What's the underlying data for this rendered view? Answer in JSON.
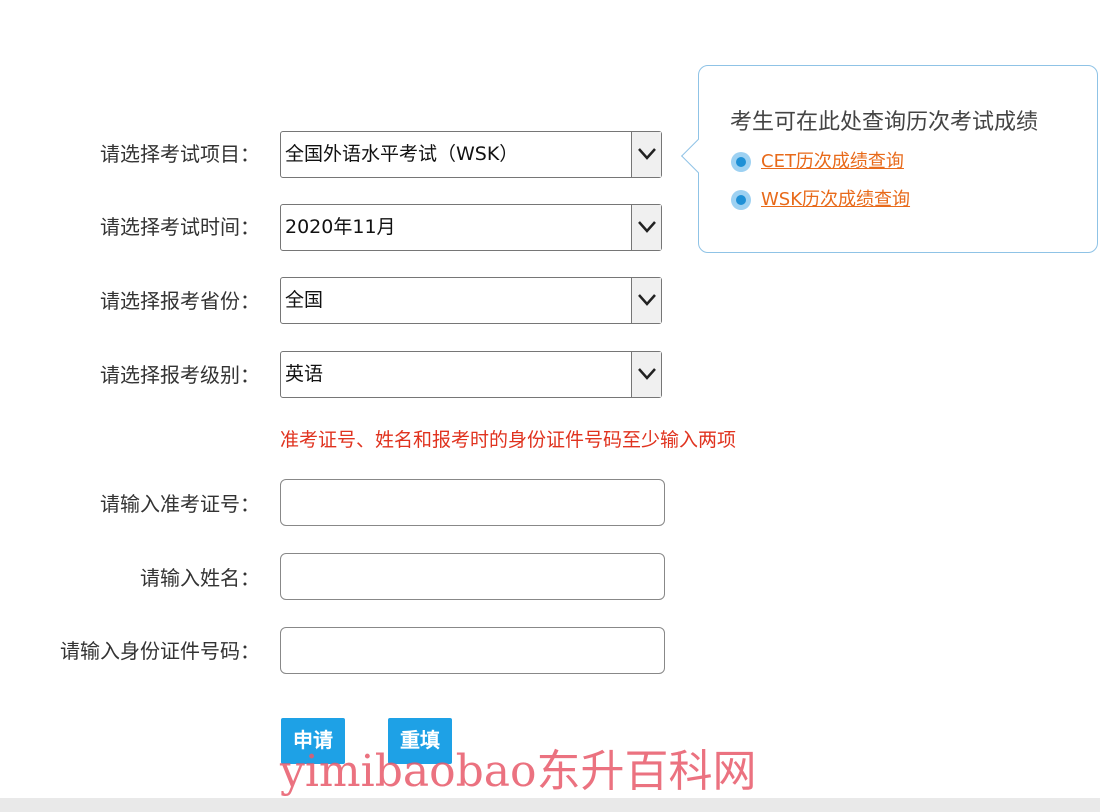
{
  "form": {
    "exam_item": {
      "label": "请选择考试项目：",
      "value": "全国外语水平考试（WSK）"
    },
    "exam_time": {
      "label": "请选择考试时间：",
      "value": "2020年11月"
    },
    "province": {
      "label": "请选择报考省份：",
      "value": "全国"
    },
    "level": {
      "label": "请选择报考级别：",
      "value": "英语"
    },
    "notice": "准考证号、姓名和报考时的身份证件号码至少输入两项",
    "ticket_no": {
      "label": "请输入准考证号：",
      "value": ""
    },
    "name": {
      "label": "请输入姓名：",
      "value": ""
    },
    "id_no": {
      "label": "请输入身份证件号码：",
      "value": ""
    },
    "buttons": {
      "submit": "申请",
      "reset": "重填"
    }
  },
  "tooltip": {
    "title": "考生可在此处查询历次考试成绩",
    "links": [
      "CET历次成绩查询",
      "WSK历次成绩查询"
    ]
  },
  "watermark": "yimibaobao东升百科网",
  "colors": {
    "button": "#1ea1e6",
    "notice": "#e0331f",
    "link": "#e86a1a",
    "tooltip_border": "#8fc3e6"
  },
  "icons": [
    "chevron-down-icon",
    "radio-dot-icon"
  ]
}
